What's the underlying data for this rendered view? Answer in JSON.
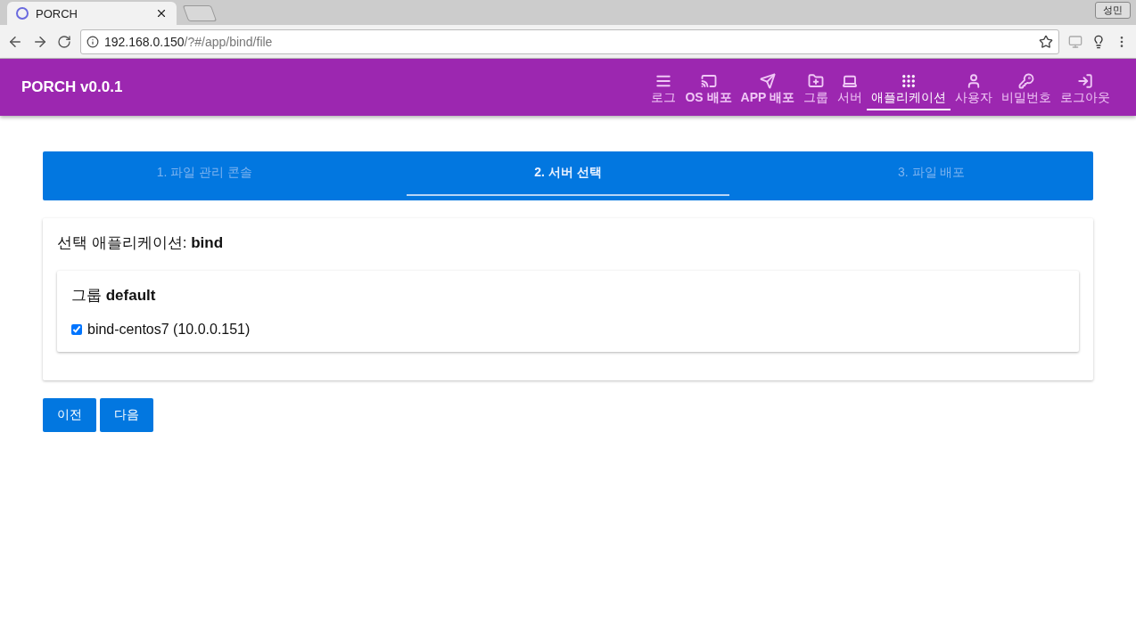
{
  "browser": {
    "tab_title": "PORCH",
    "profile": "성민",
    "url_host": "192.168.0.150",
    "url_path": "/?#/app/bind/file"
  },
  "app_bar": {
    "title": "PORCH v0.0.1",
    "nav": [
      {
        "label": "로그",
        "bold": false,
        "selected": false
      },
      {
        "label": "OS 배포",
        "bold": true,
        "selected": false
      },
      {
        "label": "APP 배포",
        "bold": true,
        "selected": false
      },
      {
        "label": "그룹",
        "bold": false,
        "selected": false
      },
      {
        "label": "서버",
        "bold": false,
        "selected": false
      },
      {
        "label": "애플리케이션",
        "bold": false,
        "selected": true
      },
      {
        "label": "사용자",
        "bold": false,
        "selected": false
      },
      {
        "label": "비밀번호",
        "bold": false,
        "selected": false
      },
      {
        "label": "로그아웃",
        "bold": false,
        "selected": false
      }
    ]
  },
  "stepper": [
    {
      "label": "1. 파일 관리 콘솔",
      "selected": false
    },
    {
      "label": "2. 서버 선택",
      "selected": true
    },
    {
      "label": "3. 파일 배포",
      "selected": false
    }
  ],
  "card": {
    "heading": "선택 애플리케이션: **bind**",
    "group": {
      "heading": "그룹 **default**",
      "servers": [
        {
          "label": "bind-centos7 (10.0.0.151)",
          "checked": true
        }
      ]
    }
  },
  "buttons": [
    "이전",
    "다음"
  ]
}
